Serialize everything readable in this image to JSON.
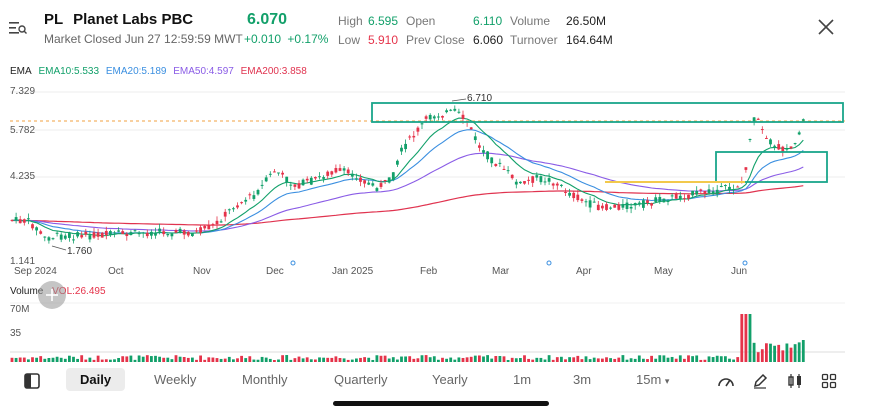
{
  "header": {
    "symbol": "PL",
    "name": "Planet Labs PBC",
    "price": "6.070",
    "status": "Market Closed Jun 27 12:59:59 MWT",
    "change": "+0.010",
    "change_pct": "+0.17%",
    "stats": {
      "high_label": "High",
      "high": "6.595",
      "low_label": "Low",
      "low": "5.910",
      "open_label": "Open",
      "open": "6.110",
      "prev_close_label": "Prev Close",
      "prev_close": "6.060",
      "volume_label": "Volume",
      "volume": "26.50M",
      "turnover_label": "Turnover",
      "turnover": "164.64M"
    }
  },
  "indicators": {
    "ema_label": "EMA",
    "ema10": "EMA10:5.533",
    "ema20": "EMA20:5.189",
    "ema50": "EMA50:4.597",
    "ema200": "EMA200:3.858",
    "vol_label": "Volume",
    "vol_value": "VOL:26.495"
  },
  "colors": {
    "up": "#12a06a",
    "down": "#e5334a",
    "ema10": "#12a06a",
    "ema20": "#3b8fe0",
    "ema50": "#8a5ce6",
    "ema200": "#e0334f",
    "highlight": "#1aa58a"
  },
  "chart_data": {
    "type": "candlestick",
    "y_ticks": [
      "7.329",
      "5.782",
      "4.235",
      "1.141"
    ],
    "x_ticks": [
      "Sep 2024",
      "Oct",
      "Nov",
      "Dec",
      "Jan 2025",
      "Feb",
      "Mar",
      "Apr",
      "May",
      "Jun"
    ],
    "annotations": {
      "high_marker": "6.710",
      "low_marker": "1.760"
    },
    "volume_ticks": [
      "70M",
      "35"
    ],
    "ylim": [
      1.141,
      7.329
    ]
  },
  "toolbar": {
    "tabs": [
      "Daily",
      "Weekly",
      "Monthly",
      "Quarterly",
      "Yearly",
      "1m",
      "3m",
      "15m"
    ],
    "active": "Daily"
  }
}
